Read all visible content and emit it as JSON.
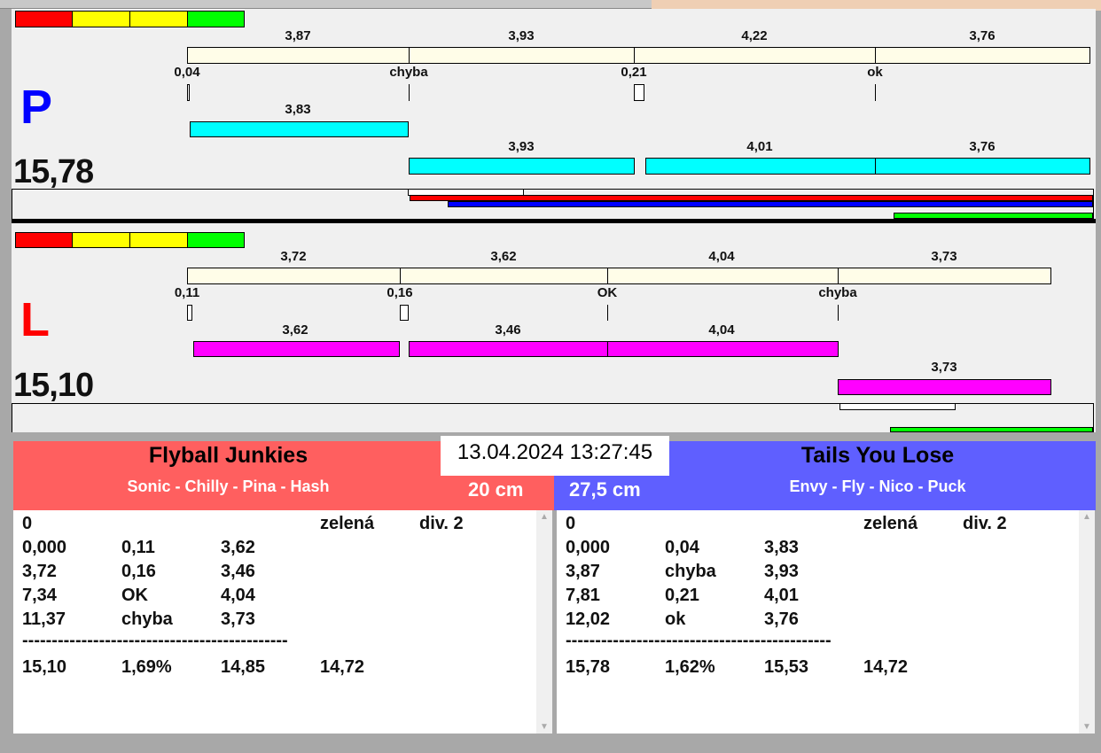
{
  "colors": {
    "strip": [
      "#ff0000",
      "#ffff00",
      "#ffff00",
      "#00ff00"
    ],
    "p": "#0000ff",
    "l": "#ff0000",
    "team_left": "#ff5f5f",
    "team_right": "#5f5fff"
  },
  "lane_p": {
    "letter": "P",
    "total": "15,78",
    "run_labels": [
      "3,87",
      "3,93",
      "4,22",
      "3,76"
    ],
    "markers": [
      "0,04",
      "chyba",
      "0,21",
      "ok"
    ],
    "dog_labels": [
      "3,83",
      "3,93",
      "4,01",
      "3,76"
    ]
  },
  "lane_l": {
    "letter": "L",
    "total": "15,10",
    "run_labels": [
      "3,72",
      "3,62",
      "4,04",
      "3,73"
    ],
    "markers": [
      "0,11",
      "0,16",
      "OK",
      "chyba"
    ],
    "dog_labels": [
      "3,62",
      "3,46",
      "4,04",
      "3,73"
    ]
  },
  "datetime": "13.04.2024 13:27:45",
  "left_team": {
    "name": "Flyball Junkies",
    "dogs": "Sonic - Chilly - Pina - Hash",
    "height": "20 cm",
    "header": [
      "0",
      "zelená",
      "div. 2"
    ],
    "rows": [
      [
        "0,000",
        "0,11",
        "3,62"
      ],
      [
        "3,72",
        "0,16",
        "3,46"
      ],
      [
        "7,34",
        "OK",
        "4,04"
      ],
      [
        "11,37",
        "chyba",
        "3,73"
      ]
    ],
    "separator": "---------------------------------------------",
    "summary": [
      "15,10",
      "1,69%",
      "14,85",
      "14,72"
    ]
  },
  "right_team": {
    "name": "Tails You Lose",
    "dogs": "Envy - Fly - Nico - Puck",
    "height": "27,5 cm",
    "header": [
      "0",
      "zelená",
      "div. 2"
    ],
    "rows": [
      [
        "0,000",
        "0,04",
        "3,83"
      ],
      [
        "3,87",
        "chyba",
        "3,93"
      ],
      [
        "7,81",
        "0,21",
        "4,01"
      ],
      [
        "12,02",
        "ok",
        "3,76"
      ]
    ],
    "separator": "---------------------------------------------",
    "summary": [
      "15,78",
      "1,62%",
      "15,53",
      "14,72"
    ]
  },
  "scroll": {
    "up": "▲",
    "down": "▼"
  }
}
